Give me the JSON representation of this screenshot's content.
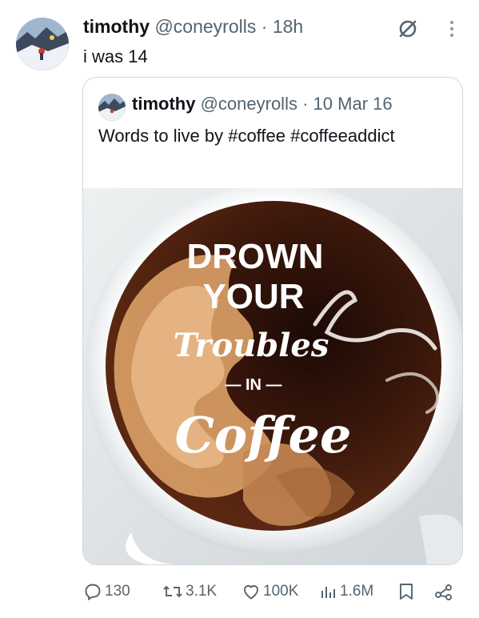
{
  "post": {
    "name": "timothy",
    "handle": "@coneyrolls",
    "separator": "·",
    "time": "18h",
    "text": "i was 14"
  },
  "quoted": {
    "name": "timothy",
    "handle": "@coneyrolls",
    "separator": "·",
    "date": "10 Mar 16",
    "text": "Words to live by #coffee #coffeeaddict",
    "image_text": {
      "line1": "DROWN",
      "line2": "YOUR",
      "line3": "Troubles",
      "line4": "— IN —",
      "line5": "Coffee"
    }
  },
  "actions": {
    "replies": "130",
    "reposts": "3.1K",
    "likes": "100K",
    "views": "1.6M"
  },
  "icons": {
    "header_action": "no-circle-icon",
    "more": "more-vertical-icon",
    "reply": "reply-icon",
    "repost": "repost-icon",
    "like": "heart-icon",
    "views": "bar-chart-icon",
    "bookmark": "bookmark-icon",
    "share": "share-icon"
  },
  "colors": {
    "text": "#0f1419",
    "secondary": "#536471",
    "border": "#cfd9de",
    "coffee_dark": "#2a120a",
    "cream": "#d9a26e"
  }
}
